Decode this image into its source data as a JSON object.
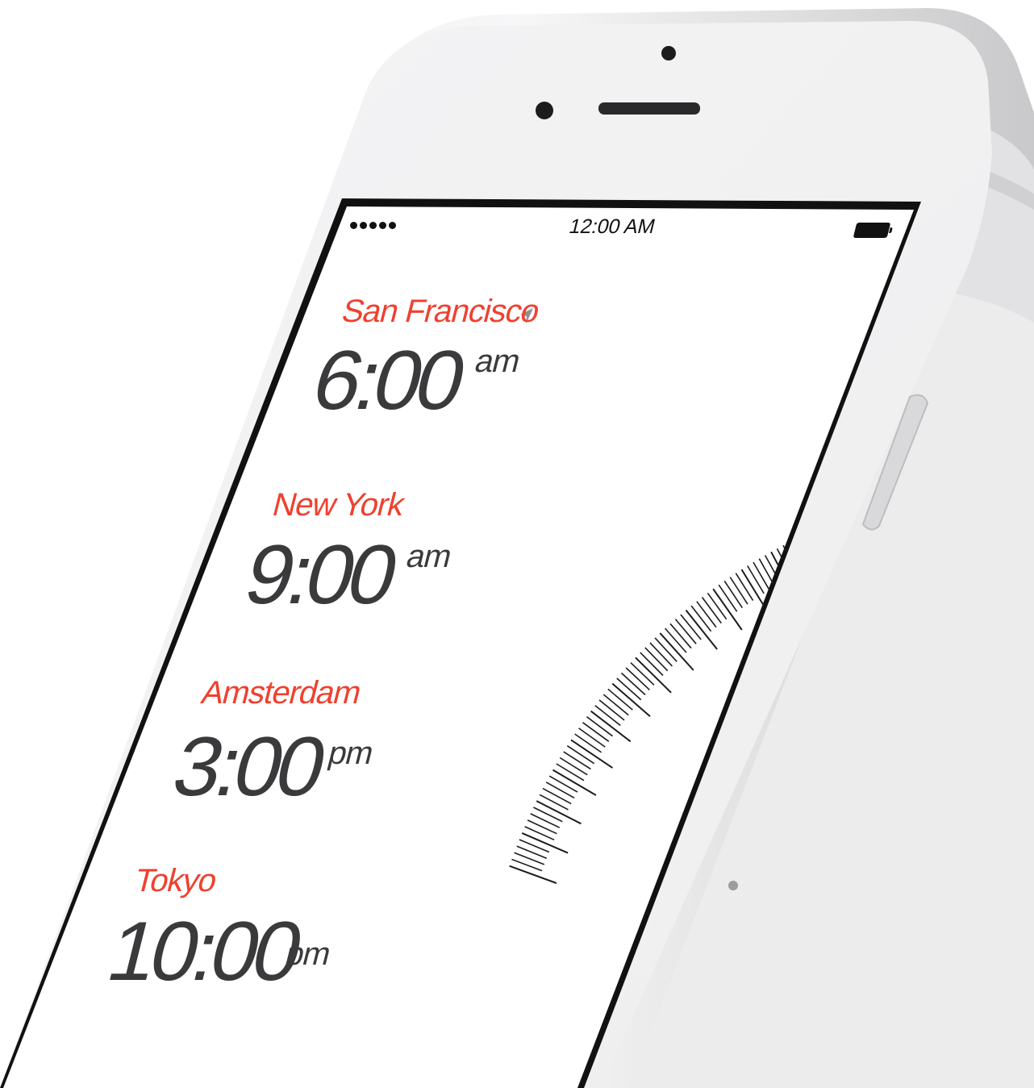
{
  "status_bar": {
    "signal_dots": 5,
    "time": "12:00 AM",
    "battery": "full"
  },
  "clocks": [
    {
      "city": "San Francisco",
      "time": "6:00",
      "period": "am",
      "location_icon": "location-arrow-icon"
    },
    {
      "city": "New York",
      "time": "9:00",
      "period": "am"
    },
    {
      "city": "Amsterdam",
      "time": "3:00",
      "period": "pm"
    },
    {
      "city": "Tokyo",
      "time": "10:00",
      "period": "pm"
    }
  ],
  "colors": {
    "city": "#f0402f",
    "time": "#3a3a3c",
    "phone_body": "#f2f2f2",
    "bezel": "#111111"
  }
}
